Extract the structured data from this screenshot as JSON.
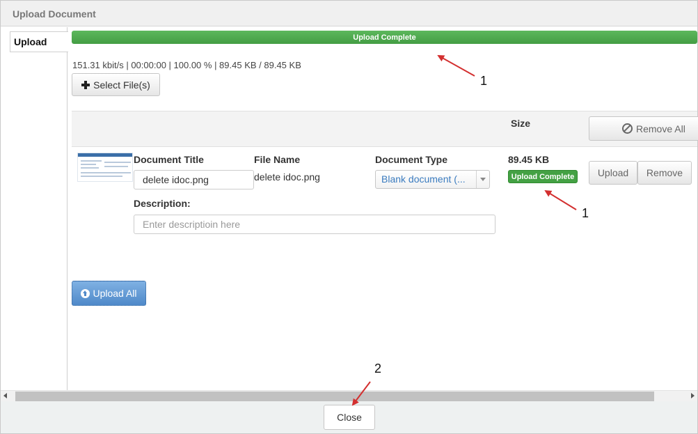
{
  "dialog": {
    "title": "Upload Document"
  },
  "tabs": [
    {
      "label": "Upload"
    }
  ],
  "progress": {
    "label": "Upload Complete",
    "percent": 100
  },
  "stats": "151.31 kbit/s | 00:00:00 | 100.00 % | 89.45 KB / 89.45 KB",
  "toolbar": {
    "select_files_label": "Select File(s)",
    "upload_all_label": "Upload All"
  },
  "table": {
    "size_header": "Size",
    "remove_all_label": "Remove All"
  },
  "file_row": {
    "document_title_label": "Document Title",
    "document_title_value": "delete idoc.png",
    "file_name_label": "File Name",
    "file_name_value": "delete idoc.png",
    "document_type_label": "Document Type",
    "document_type_value": "Blank document (...",
    "size_value": "89.45 KB",
    "status_badge": "Upload Complete",
    "upload_label": "Upload",
    "remove_label": "Remove",
    "description_label": "Description:",
    "description_placeholder": "Enter descriptioin here",
    "description_value": ""
  },
  "footer": {
    "close_label": "Close"
  },
  "annotations": {
    "marker_1": "1",
    "marker_2": "2"
  },
  "colors": {
    "success": "#44a144",
    "annotation_arrow": "#d32f2f",
    "select_value": "#3a7bbf"
  },
  "icons": {
    "select_files": "plus-icon",
    "remove_all": "ban-icon",
    "upload_all": "circle-arrow-up-icon",
    "dropdown": "chevron-down-icon"
  }
}
